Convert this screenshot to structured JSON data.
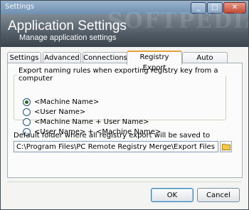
{
  "window": {
    "title": "Settings"
  },
  "header": {
    "title": "Application Settings",
    "subtitle": "Manage application settings",
    "watermark": "SOFTPEDIA"
  },
  "tabs": [
    {
      "label": "Settings"
    },
    {
      "label": "Advanced"
    },
    {
      "label": "Connections"
    },
    {
      "label": "Registry Export",
      "active": true
    },
    {
      "label": "Auto Execute"
    }
  ],
  "export_rules": {
    "legend": "Export naming rules when exporting registry key from a computer",
    "options": [
      {
        "label": "<Machine Name>",
        "selected": true
      },
      {
        "label": "<User Name>",
        "selected": false
      },
      {
        "label": "<Machine Name + User Name>",
        "selected": false
      },
      {
        "label": "<User Name> + <Machine Name>",
        "selected": false
      }
    ]
  },
  "default_folder": {
    "label": "Default folder where all registry export will be saved to",
    "value": "C:\\Program Files\\PC Remote Registry Merge\\Export Files"
  },
  "buttons": {
    "ok": "OK",
    "cancel": "Cancel"
  }
}
